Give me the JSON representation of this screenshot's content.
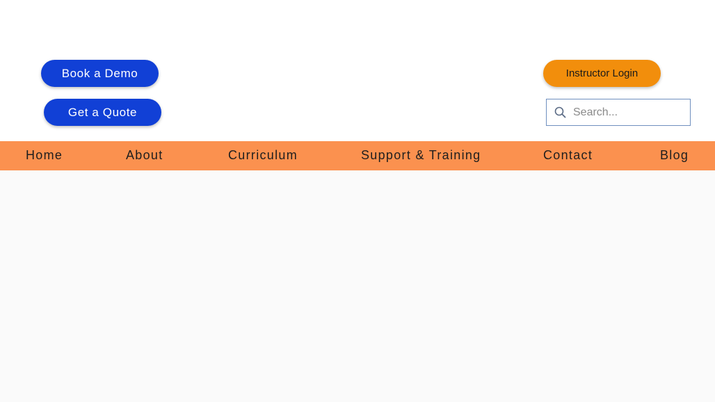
{
  "header": {
    "book_demo_label": "Book a Demo",
    "get_quote_label": "Get a Quote",
    "instructor_login_label": "Instructor Login",
    "search": {
      "placeholder": "Search...",
      "value": ""
    }
  },
  "nav": {
    "items": [
      {
        "label": "Home"
      },
      {
        "label": "About"
      },
      {
        "label": "Curriculum"
      },
      {
        "label": "Support & Training"
      },
      {
        "label": "Contact"
      },
      {
        "label": "Blog"
      }
    ]
  },
  "colors": {
    "primary_button": "#1140d6",
    "login_button": "#f28e0c",
    "nav_bar": "#fb914f",
    "page_background": "#fafafa"
  },
  "icons": {
    "search": "search-icon"
  }
}
